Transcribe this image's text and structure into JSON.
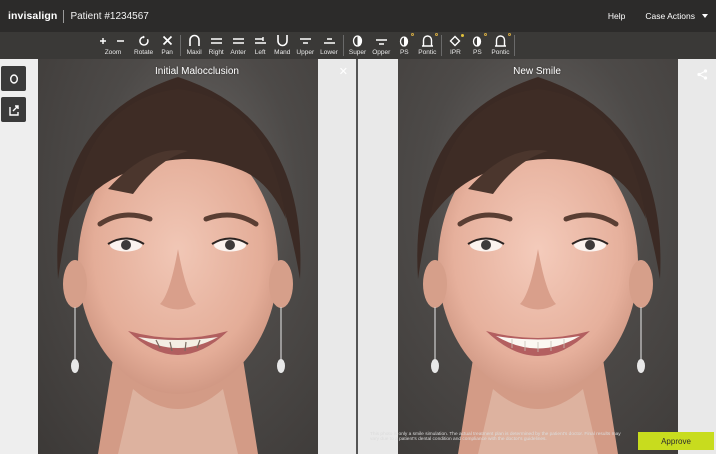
{
  "header": {
    "brand": "invisalign",
    "patient": "Patient #1234567",
    "help_label": "Help",
    "case_actions_label": "Case Actions"
  },
  "toolbar": {
    "groups": [
      [
        {
          "label": "Zoom",
          "icon": "plus-minus-icon"
        },
        {
          "label": "Rotate",
          "icon": "rotate-icon"
        },
        {
          "label": "Pan",
          "icon": "pan-cross-icon"
        }
      ],
      [
        {
          "label": "Maxil",
          "icon": "maxillary-arch-icon"
        },
        {
          "label": "Right",
          "icon": "right-view-icon"
        },
        {
          "label": "Anter",
          "icon": "anterior-view-icon"
        },
        {
          "label": "Left",
          "icon": "left-view-icon"
        },
        {
          "label": "Mand",
          "icon": "mandibular-arch-icon"
        },
        {
          "label": "Upper",
          "icon": "upper-jaw-icon"
        },
        {
          "label": "Lower",
          "icon": "lower-jaw-icon"
        }
      ],
      [
        {
          "label": "Super",
          "icon": "superimpose-icon"
        },
        {
          "label": "Opper",
          "icon": "occlusal-icon"
        },
        {
          "label": "PS",
          "icon": "ps-icon"
        },
        {
          "label": "Pontic",
          "icon": "pontic-icon"
        }
      ],
      [
        {
          "label": "IPR",
          "icon": "ipr-diamond-icon"
        },
        {
          "label": "PS",
          "icon": "ps-icon"
        },
        {
          "label": "Pontic",
          "icon": "pontic-icon"
        }
      ]
    ]
  },
  "left_panel": {
    "title": "Initial Malocclusion"
  },
  "right_panel": {
    "title": "New Smile"
  },
  "disclaimer": "This photo is only a smile simulation. The actual treatment plan is determined by the patient's doctor. Final results may vary due to a patient's dental condition and compliance with the doctor's guidelines.",
  "approve_label": "Approve",
  "colors": {
    "approve": "#c8dc1e",
    "topbar": "#2c2b2a",
    "toolbar": "#3a3937"
  }
}
